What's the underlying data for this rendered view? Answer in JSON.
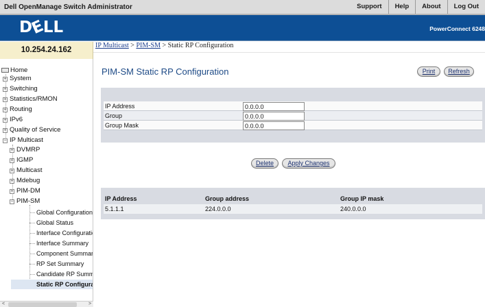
{
  "header": {
    "title": "Dell OpenManage Switch Administrator",
    "links": [
      "Support",
      "Help",
      "About",
      "Log Out"
    ]
  },
  "banner": {
    "logo": "DELL",
    "product": "PowerConnect 6248"
  },
  "left": {
    "ip": "10.254.24.162",
    "nav": {
      "home": "Home",
      "system": "System",
      "switching": "Switching",
      "statistics": "Statistics/RMON",
      "routing": "Routing",
      "ipv6": "IPv6",
      "qos": "Quality of Service",
      "ip_multicast": "IP Multicast",
      "dvmrp": "DVMRP",
      "igmp": "IGMP",
      "multicast": "Multicast",
      "mdebug": "Mdebug",
      "pim_dm": "PIM-DM",
      "pim_sm": "PIM-SM",
      "global_config": "Global Configuration",
      "global_status": "Global Status",
      "iface_config": "Interface Configuration",
      "iface_summary": "Interface Summary",
      "component_summary": "Component Summary",
      "rp_set_summary": "RP Set Summary",
      "candidate_rp": "Candidate RP Summary",
      "static_rp": "Static RP Configuration"
    },
    "expander_symbol": "+",
    "scroll_left": "<",
    "scroll_right": ">"
  },
  "breadcrumb": {
    "link1": "IP Multicast",
    "sep1": " > ",
    "link2": "PIM-SM",
    "sep2": " > ",
    "current": "Static RP Configuration"
  },
  "main": {
    "title": "PIM-SM Static RP Configuration",
    "print": "Print",
    "refresh": "Refresh",
    "form": {
      "ip_label": "IP Address",
      "ip_value": "0.0.0.0",
      "group_label": "Group",
      "group_value": "0.0.0.0",
      "mask_label": "Group Mask",
      "mask_value": "0.0.0.0"
    },
    "delete": "Delete",
    "apply": "Apply Changes",
    "table": {
      "headers": [
        "IP Address",
        "Group address",
        "Group IP mask"
      ],
      "rows": [
        [
          "5.1.1.1",
          "224.0.0.0",
          "240.0.0.0"
        ]
      ]
    }
  }
}
